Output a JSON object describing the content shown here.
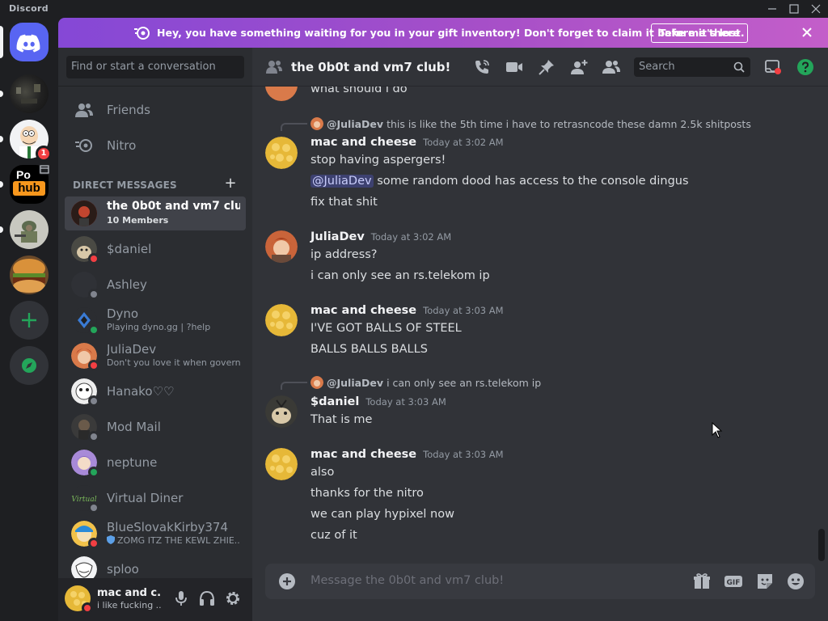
{
  "window": {
    "app_name": "Discord",
    "controls": [
      "minimize",
      "maximize",
      "close"
    ]
  },
  "servers": [
    {
      "name": "server-dark",
      "colors": [
        "#1a1a1a",
        "#3c3c3c"
      ]
    },
    {
      "name": "server-peter",
      "badge": "1"
    },
    {
      "name": "server-hub",
      "text_top": "Po",
      "text_bottom": "hub"
    },
    {
      "name": "server-military"
    },
    {
      "name": "server-burger"
    }
  ],
  "banner": {
    "text": "Hey, you have something waiting for you in your gift inventory! Don't forget to claim it before it's lost.",
    "button": "Take me there"
  },
  "sidebar": {
    "search_placeholder": "Find or start a conversation",
    "nav": [
      {
        "label": "Friends",
        "icon": "friends-icon"
      },
      {
        "label": "Nitro",
        "icon": "nitro-icon"
      }
    ],
    "dm_header": "DIRECT MESSAGES",
    "dms": [
      {
        "name": "the 0b0t and vm7 club!",
        "sub": "10 Members",
        "active": true,
        "status": ""
      },
      {
        "name": "$daniel",
        "sub": "",
        "status": "dnd"
      },
      {
        "name": "Ashley",
        "sub": "",
        "status": "offline"
      },
      {
        "name": "Dyno",
        "sub": "Playing dyno.gg | ?help",
        "status": "online"
      },
      {
        "name": "JuliaDev",
        "sub": "Don't you love it when govern...",
        "status": "dnd"
      },
      {
        "name": "Hanako♡♡",
        "sub": "",
        "status": "offline"
      },
      {
        "name": "Mod Mail",
        "sub": "",
        "status": "offline"
      },
      {
        "name": "neptune",
        "sub": "",
        "status": "online"
      },
      {
        "name": "Virtual Diner",
        "sub": "",
        "status": "offline"
      },
      {
        "name": "BlueSlovakKirby374",
        "sub": "ZOMG ITZ THE KEWL ZHIE...",
        "status": "dnd"
      },
      {
        "name": "sploo",
        "sub": "",
        "status": "offline"
      }
    ]
  },
  "user": {
    "name": "mac and c...",
    "status": "i like fucking ..."
  },
  "channel": {
    "title": "the 0b0t and vm7 club!",
    "search_placeholder": "Search"
  },
  "messages": [
    {
      "partial_line": "what should i do"
    },
    {
      "reply": {
        "author": "@JuliaDev",
        "text": "this is like the 5th time i have to retrasncode these damn 2.5k shitposts"
      },
      "author": "mac and cheese",
      "time": "Today at 3:02 AM",
      "lines": [
        "stop having aspergers!",
        "some random dood has access to the console dingus",
        "fix that shit"
      ],
      "mention": "@JuliaDev"
    },
    {
      "author": "JuliaDev",
      "time": "Today at 3:02 AM",
      "lines": [
        "ip address?",
        "i can only see an rs.telekom ip"
      ]
    },
    {
      "author": "mac and cheese",
      "time": "Today at 3:03 AM",
      "lines": [
        "I'VE GOT BALLS OF STEEL",
        "BALLS BALLS BALLS"
      ]
    },
    {
      "reply": {
        "author": "@JuliaDev",
        "text": "i can only see an rs.telekom ip"
      },
      "author": "$daniel",
      "time": "Today at 3:03 AM",
      "lines": [
        "That is me"
      ]
    },
    {
      "author": "mac and cheese",
      "time": "Today at 3:03 AM",
      "lines": [
        "also",
        "thanks for the nitro",
        "we can play hypixel now",
        "cuz of it"
      ]
    }
  ],
  "composer": {
    "placeholder": "Message the 0b0t and vm7 club!",
    "gif_label": "GIF"
  },
  "colors": {
    "accent": "#5865f2",
    "online": "#23a55a",
    "dnd": "#f23f43",
    "offline": "#80848e",
    "banner_start": "#8548d6",
    "banner_end": "#c35ec9",
    "help_green": "#23a55a"
  }
}
